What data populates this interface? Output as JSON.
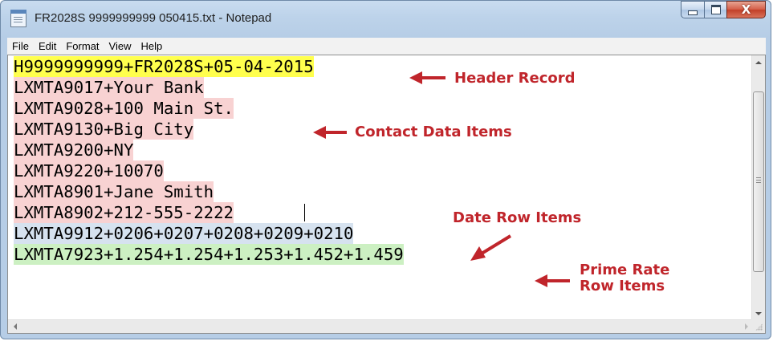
{
  "window": {
    "title": "FR2028S 9999999999 050415.txt - Notepad",
    "close_glyph": "X"
  },
  "menu": [
    "File",
    "Edit",
    "Format",
    "View",
    "Help"
  ],
  "document": {
    "lines": [
      "H9999999999+FR2028S+05-04-2015",
      "LXMTA9017+Your Bank",
      "LXMTA9028+100 Main St.",
      "LXMTA9130+Big City",
      "LXMTA9200+NY",
      "LXMTA9220+10070",
      "LXMTA8901+Jane Smith",
      "LXMTA8902+212-555-2222",
      "LXMTA9912+0206+0207+0208+0209+0210",
      "LXMTA7923+1.254+1.254+1.253+1.452+1.459"
    ]
  },
  "annotations": {
    "header": "Header Record",
    "contact": "Contact Data Items",
    "date": "Date Row Items",
    "prime_line1": "Prime Rate",
    "prime_line2": "Row Items"
  },
  "colors": {
    "annotation_red": "#c0252b",
    "header_highlight": "#ffff4d",
    "contact_highlight": "#f8d2d2",
    "date_highlight": "#d6e2ef",
    "prime_highlight": "#ccf0c2"
  },
  "icons": {
    "app": "notepad-icon",
    "minimize": "minimize-icon",
    "maximize": "maximize-icon",
    "close": "close-icon"
  }
}
